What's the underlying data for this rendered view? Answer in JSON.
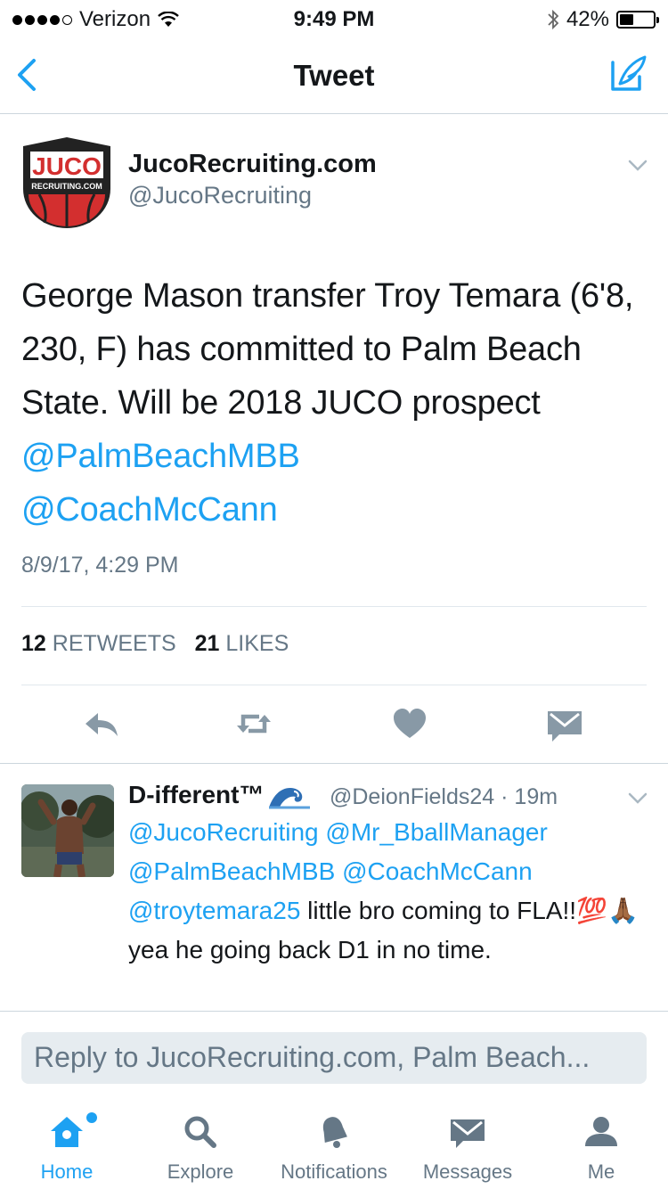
{
  "status_bar": {
    "carrier": "Verizon",
    "time": "9:49 PM",
    "battery_percent": "42%",
    "battery_level": 0.42
  },
  "nav": {
    "title": "Tweet",
    "back_icon": "chevron-left-icon",
    "compose_icon": "compose-icon"
  },
  "tweet": {
    "author_name": "JucoRecruiting.com",
    "author_handle": "@JucoRecruiting",
    "avatar_text_top": "JUCO",
    "avatar_text_bottom": "RECRUITING.COM",
    "text_before": "George Mason transfer Troy Temara (6'8, 230, F) has committed to Palm Beach State. Will be 2018 JUCO prospect ",
    "mention_1": "@PalmBeachMBB",
    "mention_2": "@CoachMcCann",
    "date": "8/9/17, 4:29 PM",
    "retweets_count": "12",
    "retweets_label": "RETWEETS",
    "likes_count": "21",
    "likes_label": "LIKES"
  },
  "reply": {
    "name": "D-ifferent™",
    "handle_time": "@DeionFields24 · 19m",
    "mention_1": "@JucoRecruiting",
    "mention_2": "@Mr_BballManager",
    "mention_3": "@PalmBeachMBB",
    "mention_4": "@CoachMcCann",
    "mention_5": "@troytemara25",
    "text_1": " little bro coming to FLA!!",
    "emoji": "💯🙏🏾",
    "text_2": " yea he going back D1 in no time."
  },
  "reply_box": {
    "placeholder": "Reply to JucoRecruiting.com, Palm Beach..."
  },
  "tabs": [
    {
      "label": "Home",
      "icon": "home-icon",
      "active": true
    },
    {
      "label": "Explore",
      "icon": "search-icon",
      "active": false
    },
    {
      "label": "Notifications",
      "icon": "bell-icon",
      "active": false
    },
    {
      "label": "Messages",
      "icon": "envelope-icon",
      "active": false
    },
    {
      "label": "Me",
      "icon": "person-icon",
      "active": false
    }
  ],
  "colors": {
    "accent": "#1da1f2",
    "secondary_text": "#657786",
    "icon_gray": "#8899a6",
    "logo_red": "#d32f2f"
  }
}
